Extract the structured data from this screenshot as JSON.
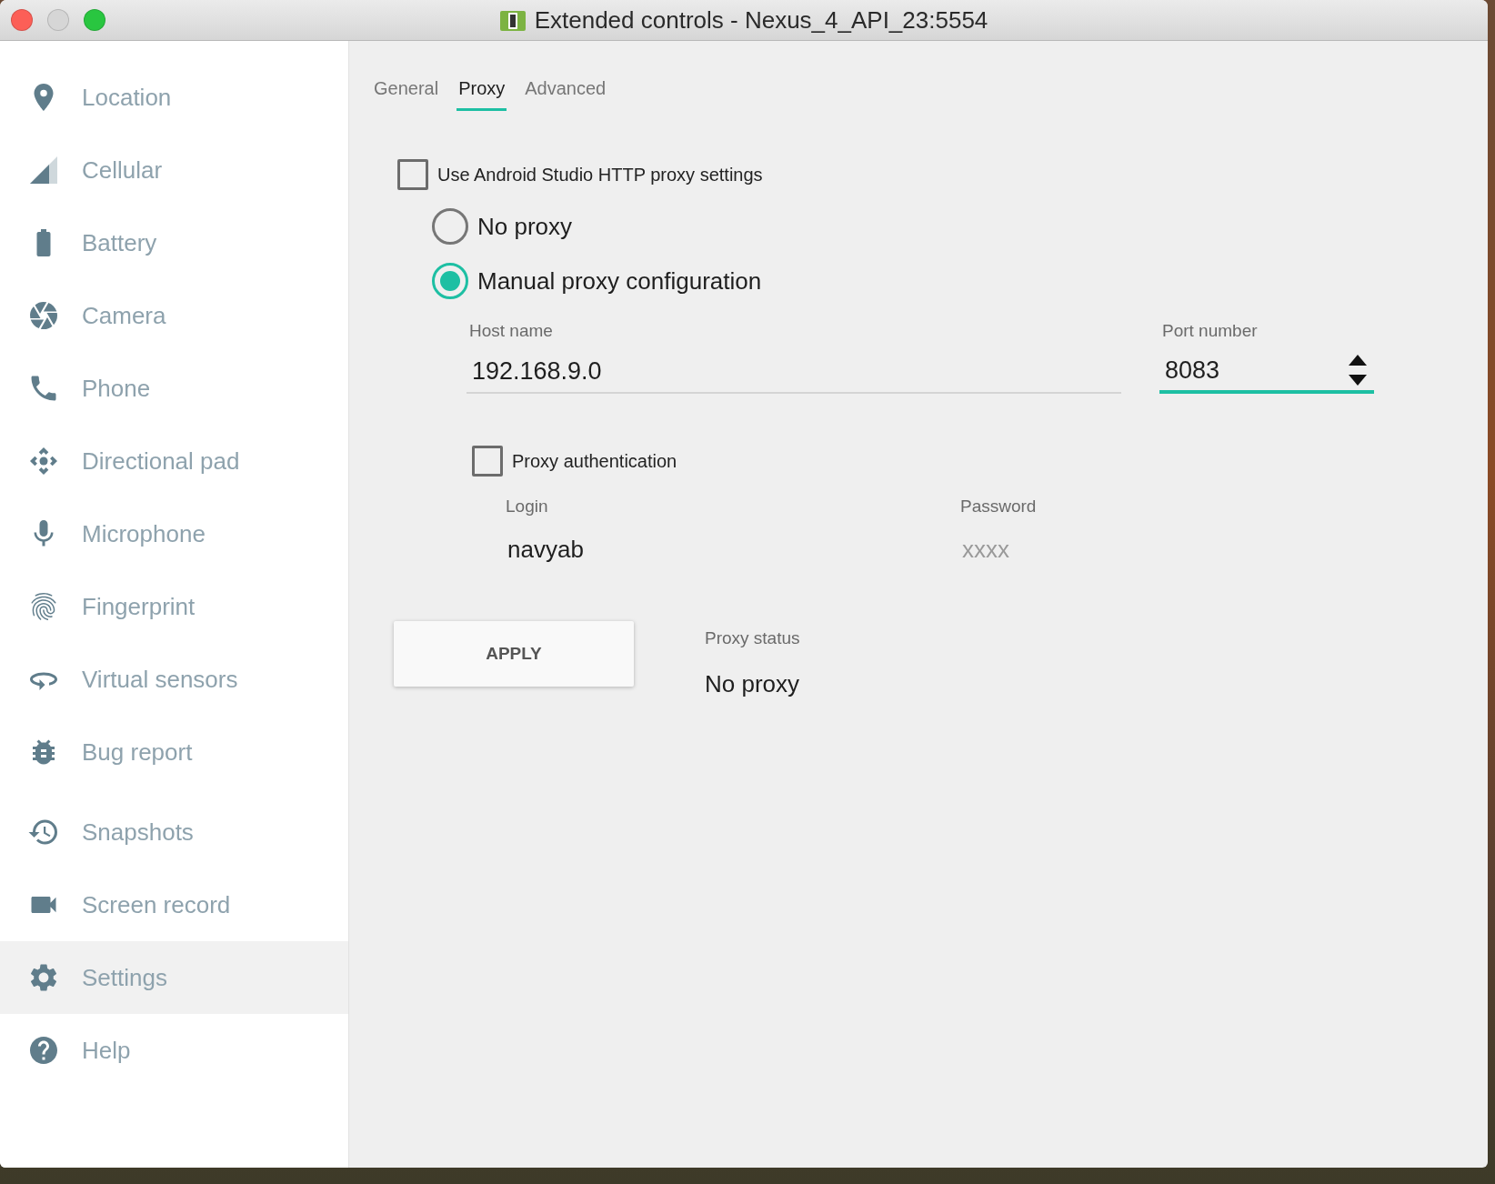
{
  "window": {
    "title": "Extended controls - Nexus_4_API_23:5554"
  },
  "sidebar": {
    "sections": [
      {
        "items": [
          {
            "label": "Location",
            "selected": false
          },
          {
            "label": "Cellular",
            "selected": false
          },
          {
            "label": "Battery",
            "selected": false
          },
          {
            "label": "Camera",
            "selected": false
          },
          {
            "label": "Phone",
            "selected": false
          },
          {
            "label": "Directional pad",
            "selected": false
          },
          {
            "label": "Microphone",
            "selected": false
          },
          {
            "label": "Fingerprint",
            "selected": false
          },
          {
            "label": "Virtual sensors",
            "selected": false
          },
          {
            "label": "Bug report",
            "selected": false
          }
        ]
      },
      {
        "items": [
          {
            "label": "Snapshots",
            "selected": false
          },
          {
            "label": "Screen record",
            "selected": false
          },
          {
            "label": "Settings",
            "selected": true
          },
          {
            "label": "Help",
            "selected": false
          }
        ]
      }
    ]
  },
  "tabs": [
    {
      "label": "General",
      "selected": false
    },
    {
      "label": "Proxy",
      "selected": true
    },
    {
      "label": "Advanced",
      "selected": false
    }
  ],
  "use_studio_proxy": {
    "label": "Use Android Studio HTTP proxy settings",
    "checked": false
  },
  "proxy_modes": [
    {
      "label": "No proxy",
      "selected": false
    },
    {
      "label": "Manual proxy configuration",
      "selected": true
    }
  ],
  "host": {
    "label": "Host name",
    "value": "192.168.9.0",
    "focused": false
  },
  "port": {
    "label": "Port number",
    "value": "8083",
    "focused": true
  },
  "proxy_auth": {
    "label": "Proxy authentication",
    "checked": false
  },
  "login": {
    "label": "Login",
    "value": "navyab"
  },
  "password": {
    "label": "Password",
    "placeholder": "xxxx"
  },
  "apply_button": {
    "label": "APPLY"
  },
  "proxy_status": {
    "label": "Proxy status",
    "value": "No proxy"
  }
}
